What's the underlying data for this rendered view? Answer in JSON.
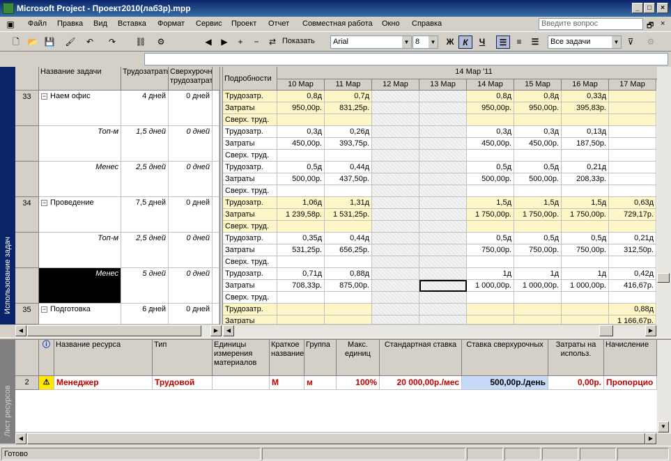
{
  "window": {
    "title": "Microsoft Project - Проект2010(лаб3р).mpp"
  },
  "menu": [
    "Файл",
    "Правка",
    "Вид",
    "Вставка",
    "Формат",
    "Сервис",
    "Проект",
    "Отчет",
    "Совместная работа",
    "Окно",
    "Справка"
  ],
  "question_placeholder": "Введите вопрос",
  "toolbar": {
    "show_label": "Показать",
    "font": "Arial",
    "size": "8",
    "bold": "Ж",
    "italic": "К",
    "underline": "Ч",
    "filter": "Все задачи"
  },
  "upper_view_label": "Использование задач",
  "lower_view_label": "Лист ресурсов",
  "task_columns": [
    "Название задачи",
    "Трудозатраты",
    "Сверхурочные трудозатраты"
  ],
  "details_header": "Подробности",
  "week_label": "14 Мар '11",
  "days": [
    "10 Мар",
    "11 Мар",
    "12 Мар",
    "13 Мар",
    "14 Мар",
    "15 Мар",
    "16 Мар",
    "17 Мар"
  ],
  "task_rows": [
    {
      "id": "33",
      "name": "Наем офис",
      "work": "4 дней",
      "ot": "0 дней",
      "summary": true,
      "rows": [
        {
          "label": "Трудозатр.",
          "vals": [
            "0,8д",
            "0,7д",
            "",
            "",
            "0,8д",
            "0,8д",
            "0,33д",
            ""
          ]
        },
        {
          "label": "Затраты",
          "vals": [
            "950,00р.",
            "831,25р.",
            "",
            "",
            "950,00р.",
            "950,00р.",
            "395,83р.",
            ""
          ]
        },
        {
          "label": "Сверх. труд.",
          "vals": [
            "",
            "",
            "",
            "",
            "",
            "",
            "",
            ""
          ]
        }
      ]
    },
    {
      "id": "",
      "name": "Топ-м",
      "work": "1,5 дней",
      "ot": "0 дней",
      "summary": false,
      "rows": [
        {
          "label": "Трудозатр.",
          "vals": [
            "0,3д",
            "0,26д",
            "",
            "",
            "0,3д",
            "0,3д",
            "0,13д",
            ""
          ]
        },
        {
          "label": "Затраты",
          "vals": [
            "450,00р.",
            "393,75р.",
            "",
            "",
            "450,00р.",
            "450,00р.",
            "187,50р.",
            ""
          ]
        },
        {
          "label": "Сверх. труд.",
          "vals": [
            "",
            "",
            "",
            "",
            "",
            "",
            "",
            ""
          ]
        }
      ]
    },
    {
      "id": "",
      "name": "Менес",
      "work": "2,5 дней",
      "ot": "0 дней",
      "summary": false,
      "rows": [
        {
          "label": "Трудозатр.",
          "vals": [
            "0,5д",
            "0,44д",
            "",
            "",
            "0,5д",
            "0,5д",
            "0,21д",
            ""
          ]
        },
        {
          "label": "Затраты",
          "vals": [
            "500,00р.",
            "437,50р.",
            "",
            "",
            "500,00р.",
            "500,00р.",
            "208,33р.",
            ""
          ]
        },
        {
          "label": "Сверх. труд.",
          "vals": [
            "",
            "",
            "",
            "",
            "",
            "",
            "",
            ""
          ]
        }
      ]
    },
    {
      "id": "34",
      "name": "Проведение",
      "work": "7,5 дней",
      "ot": "0 дней",
      "summary": true,
      "rows": [
        {
          "label": "Трудозатр.",
          "vals": [
            "1,06д",
            "1,31д",
            "",
            "",
            "1,5д",
            "1,5д",
            "1,5д",
            "0,63д"
          ]
        },
        {
          "label": "Затраты",
          "vals": [
            "1 239,58р.",
            "1 531,25р.",
            "",
            "",
            "1 750,00р.",
            "1 750,00р.",
            "1 750,00р.",
            "729,17р."
          ]
        },
        {
          "label": "Сверх. труд.",
          "vals": [
            "",
            "",
            "",
            "",
            "",
            "",
            "",
            ""
          ]
        }
      ]
    },
    {
      "id": "",
      "name": "Топ-м",
      "work": "2,5 дней",
      "ot": "0 дней",
      "summary": false,
      "rows": [
        {
          "label": "Трудозатр.",
          "vals": [
            "0,35д",
            "0,44д",
            "",
            "",
            "0,5д",
            "0,5д",
            "0,5д",
            "0,21д"
          ]
        },
        {
          "label": "Затраты",
          "vals": [
            "531,25р.",
            "656,25р.",
            "",
            "",
            "750,00р.",
            "750,00р.",
            "750,00р.",
            "312,50р."
          ]
        },
        {
          "label": "Сверх. труд.",
          "vals": [
            "",
            "",
            "",
            "",
            "",
            "",
            "",
            ""
          ]
        }
      ]
    },
    {
      "id": "",
      "name": "Менес",
      "work": "5 дней",
      "ot": "0 дней",
      "summary": false,
      "selected": true,
      "rows": [
        {
          "label": "Трудозатр.",
          "vals": [
            "0,71д",
            "0,88д",
            "",
            "",
            "1д",
            "1д",
            "1д",
            "0,42д"
          ]
        },
        {
          "label": "Затраты",
          "vals": [
            "708,33р.",
            "875,00р.",
            "",
            "",
            "1 000,00р.",
            "1 000,00р.",
            "1 000,00р.",
            "416,67р."
          ]
        },
        {
          "label": "Сверх. труд.",
          "vals": [
            "",
            "",
            "",
            "",
            "",
            "",
            "",
            ""
          ]
        }
      ]
    },
    {
      "id": "35",
      "name": "Подготовка",
      "work": "6 дней",
      "ot": "0 дней",
      "summary": true,
      "rows": [
        {
          "label": "Трудозатр.",
          "vals": [
            "",
            "",
            "",
            "",
            "",
            "",
            "",
            "0,88д"
          ]
        },
        {
          "label": "Затраты",
          "vals": [
            "",
            "",
            "",
            "",
            "",
            "",
            "",
            "1 166,67р."
          ]
        }
      ]
    }
  ],
  "resource_columns": [
    "Название ресурса",
    "Тип",
    "Единицы измерения материалов",
    "Краткое название",
    "Группа",
    "Макс. единиц",
    "Стандартная ставка",
    "Ставка сверхурочных",
    "Затраты на использ.",
    "Начисление"
  ],
  "resource_row": {
    "id": "2",
    "name": "Менеджер",
    "type": "Трудовой",
    "material": "",
    "short": "М",
    "group": "м",
    "max": "100%",
    "std": "20 000,00р./мес",
    "ot": "500,00р./день",
    "cost": "0,00р.",
    "accrue": "Пропорцио"
  },
  "status": "Готово"
}
